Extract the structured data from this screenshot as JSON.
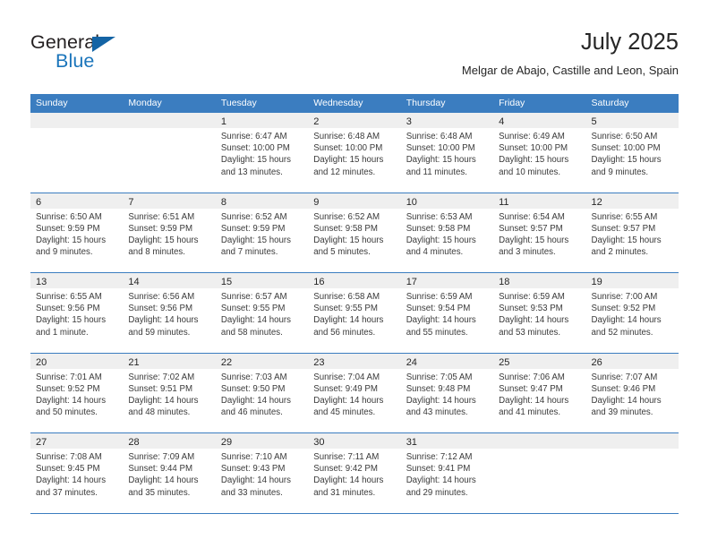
{
  "brand": {
    "name_part1": "General",
    "name_part2": "Blue",
    "accent_color": "#1b75bb",
    "triangle_color": "#1464a5"
  },
  "header": {
    "title": "July 2025",
    "subtitle": "Melgar de Abajo, Castille and Leon, Spain"
  },
  "calendar": {
    "header_bg": "#3b7dc0",
    "daynumber_bg": "#efefef",
    "weekday_names": [
      "Sunday",
      "Monday",
      "Tuesday",
      "Wednesday",
      "Thursday",
      "Friday",
      "Saturday"
    ],
    "weeks": [
      [
        {
          "day": "",
          "lines": []
        },
        {
          "day": "",
          "lines": []
        },
        {
          "day": "1",
          "lines": [
            "Sunrise: 6:47 AM",
            "Sunset: 10:00 PM",
            "Daylight: 15 hours",
            "and 13 minutes."
          ]
        },
        {
          "day": "2",
          "lines": [
            "Sunrise: 6:48 AM",
            "Sunset: 10:00 PM",
            "Daylight: 15 hours",
            "and 12 minutes."
          ]
        },
        {
          "day": "3",
          "lines": [
            "Sunrise: 6:48 AM",
            "Sunset: 10:00 PM",
            "Daylight: 15 hours",
            "and 11 minutes."
          ]
        },
        {
          "day": "4",
          "lines": [
            "Sunrise: 6:49 AM",
            "Sunset: 10:00 PM",
            "Daylight: 15 hours",
            "and 10 minutes."
          ]
        },
        {
          "day": "5",
          "lines": [
            "Sunrise: 6:50 AM",
            "Sunset: 10:00 PM",
            "Daylight: 15 hours",
            "and 9 minutes."
          ]
        }
      ],
      [
        {
          "day": "6",
          "lines": [
            "Sunrise: 6:50 AM",
            "Sunset: 9:59 PM",
            "Daylight: 15 hours",
            "and 9 minutes."
          ]
        },
        {
          "day": "7",
          "lines": [
            "Sunrise: 6:51 AM",
            "Sunset: 9:59 PM",
            "Daylight: 15 hours",
            "and 8 minutes."
          ]
        },
        {
          "day": "8",
          "lines": [
            "Sunrise: 6:52 AM",
            "Sunset: 9:59 PM",
            "Daylight: 15 hours",
            "and 7 minutes."
          ]
        },
        {
          "day": "9",
          "lines": [
            "Sunrise: 6:52 AM",
            "Sunset: 9:58 PM",
            "Daylight: 15 hours",
            "and 5 minutes."
          ]
        },
        {
          "day": "10",
          "lines": [
            "Sunrise: 6:53 AM",
            "Sunset: 9:58 PM",
            "Daylight: 15 hours",
            "and 4 minutes."
          ]
        },
        {
          "day": "11",
          "lines": [
            "Sunrise: 6:54 AM",
            "Sunset: 9:57 PM",
            "Daylight: 15 hours",
            "and 3 minutes."
          ]
        },
        {
          "day": "12",
          "lines": [
            "Sunrise: 6:55 AM",
            "Sunset: 9:57 PM",
            "Daylight: 15 hours",
            "and 2 minutes."
          ]
        }
      ],
      [
        {
          "day": "13",
          "lines": [
            "Sunrise: 6:55 AM",
            "Sunset: 9:56 PM",
            "Daylight: 15 hours",
            "and 1 minute."
          ]
        },
        {
          "day": "14",
          "lines": [
            "Sunrise: 6:56 AM",
            "Sunset: 9:56 PM",
            "Daylight: 14 hours",
            "and 59 minutes."
          ]
        },
        {
          "day": "15",
          "lines": [
            "Sunrise: 6:57 AM",
            "Sunset: 9:55 PM",
            "Daylight: 14 hours",
            "and 58 minutes."
          ]
        },
        {
          "day": "16",
          "lines": [
            "Sunrise: 6:58 AM",
            "Sunset: 9:55 PM",
            "Daylight: 14 hours",
            "and 56 minutes."
          ]
        },
        {
          "day": "17",
          "lines": [
            "Sunrise: 6:59 AM",
            "Sunset: 9:54 PM",
            "Daylight: 14 hours",
            "and 55 minutes."
          ]
        },
        {
          "day": "18",
          "lines": [
            "Sunrise: 6:59 AM",
            "Sunset: 9:53 PM",
            "Daylight: 14 hours",
            "and 53 minutes."
          ]
        },
        {
          "day": "19",
          "lines": [
            "Sunrise: 7:00 AM",
            "Sunset: 9:52 PM",
            "Daylight: 14 hours",
            "and 52 minutes."
          ]
        }
      ],
      [
        {
          "day": "20",
          "lines": [
            "Sunrise: 7:01 AM",
            "Sunset: 9:52 PM",
            "Daylight: 14 hours",
            "and 50 minutes."
          ]
        },
        {
          "day": "21",
          "lines": [
            "Sunrise: 7:02 AM",
            "Sunset: 9:51 PM",
            "Daylight: 14 hours",
            "and 48 minutes."
          ]
        },
        {
          "day": "22",
          "lines": [
            "Sunrise: 7:03 AM",
            "Sunset: 9:50 PM",
            "Daylight: 14 hours",
            "and 46 minutes."
          ]
        },
        {
          "day": "23",
          "lines": [
            "Sunrise: 7:04 AM",
            "Sunset: 9:49 PM",
            "Daylight: 14 hours",
            "and 45 minutes."
          ]
        },
        {
          "day": "24",
          "lines": [
            "Sunrise: 7:05 AM",
            "Sunset: 9:48 PM",
            "Daylight: 14 hours",
            "and 43 minutes."
          ]
        },
        {
          "day": "25",
          "lines": [
            "Sunrise: 7:06 AM",
            "Sunset: 9:47 PM",
            "Daylight: 14 hours",
            "and 41 minutes."
          ]
        },
        {
          "day": "26",
          "lines": [
            "Sunrise: 7:07 AM",
            "Sunset: 9:46 PM",
            "Daylight: 14 hours",
            "and 39 minutes."
          ]
        }
      ],
      [
        {
          "day": "27",
          "lines": [
            "Sunrise: 7:08 AM",
            "Sunset: 9:45 PM",
            "Daylight: 14 hours",
            "and 37 minutes."
          ]
        },
        {
          "day": "28",
          "lines": [
            "Sunrise: 7:09 AM",
            "Sunset: 9:44 PM",
            "Daylight: 14 hours",
            "and 35 minutes."
          ]
        },
        {
          "day": "29",
          "lines": [
            "Sunrise: 7:10 AM",
            "Sunset: 9:43 PM",
            "Daylight: 14 hours",
            "and 33 minutes."
          ]
        },
        {
          "day": "30",
          "lines": [
            "Sunrise: 7:11 AM",
            "Sunset: 9:42 PM",
            "Daylight: 14 hours",
            "and 31 minutes."
          ]
        },
        {
          "day": "31",
          "lines": [
            "Sunrise: 7:12 AM",
            "Sunset: 9:41 PM",
            "Daylight: 14 hours",
            "and 29 minutes."
          ]
        },
        {
          "day": "",
          "lines": []
        },
        {
          "day": "",
          "lines": []
        }
      ]
    ]
  }
}
